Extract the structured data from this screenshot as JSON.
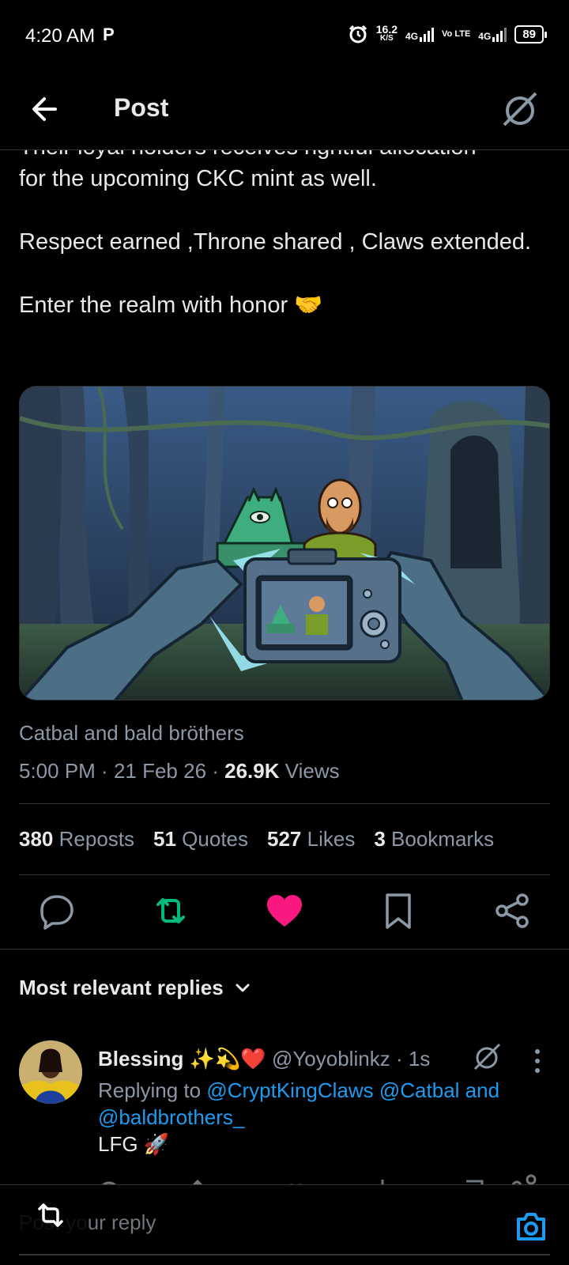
{
  "status_bar": {
    "time": "4:20 AM",
    "p_icon": "P",
    "net_speed_value": "16.2",
    "net_speed_unit": "K/S",
    "sig1": "4G",
    "volte": "Vo LTE",
    "sig2": "4G",
    "battery": "89"
  },
  "header": {
    "title": "Post"
  },
  "post": {
    "text_cut": "Their loyal holders receives rightful allocation",
    "text_line": "for the upcoming CKC mint as well.",
    "text_p2": "Respect earned ,Throne shared , Claws extended.",
    "text_p3": "Enter the realm with honor 🤝",
    "caption": "Catbal and bald bröthers",
    "time": "5:00 PM",
    "date": "21 Feb 26",
    "views_count": "26.9K",
    "views_label": "Views"
  },
  "stats": {
    "reposts_count": "380",
    "reposts_label": "Reposts",
    "quotes_count": "51",
    "quotes_label": "Quotes",
    "likes_count": "527",
    "likes_label": "Likes",
    "bookmarks_count": "3",
    "bookmarks_label": "Bookmarks"
  },
  "colors": {
    "repost": "#00ba7c",
    "like": "#f91880",
    "link": "#1d9bf0"
  },
  "replies_header": "Most relevant replies",
  "reply": {
    "name": "Blessing ✨💫❤️",
    "handle": "@Yoyoblinkz",
    "time": "1s",
    "replying_prefix": "Replying to",
    "mention1": "@CryptKingClaws",
    "mention2": "@Catbal and",
    "mention3": "@baldbrothers_",
    "text": "LFG 🚀"
  },
  "compose": {
    "placeholder": "Post your reply"
  }
}
